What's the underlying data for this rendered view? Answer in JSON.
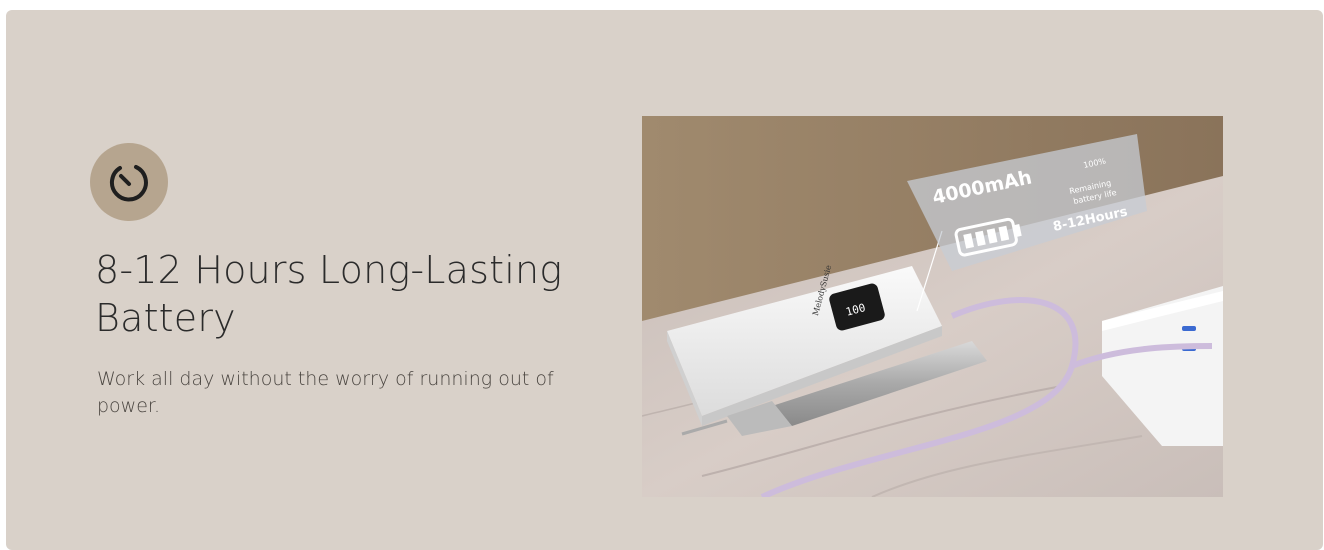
{
  "feature": {
    "icon": "timer-icon",
    "title": "8-12 Hours Long-Lasting Battery",
    "description": "Work all day without the worry of running out of power."
  },
  "product_image": {
    "callout": {
      "capacity": "4000mAh",
      "percent": "100%",
      "remaining_line1": "Remaining",
      "remaining_line2": "battery life",
      "duration": "8-12Hours",
      "icon": "battery-icon"
    },
    "brand_mark": "MelodySusie",
    "display_reading": "100"
  },
  "colors": {
    "panel_bg": "#d9d1c9",
    "icon_badge": "#b6a58f",
    "heading_text": "#2b2b2b",
    "body_text": "#4a4540"
  }
}
